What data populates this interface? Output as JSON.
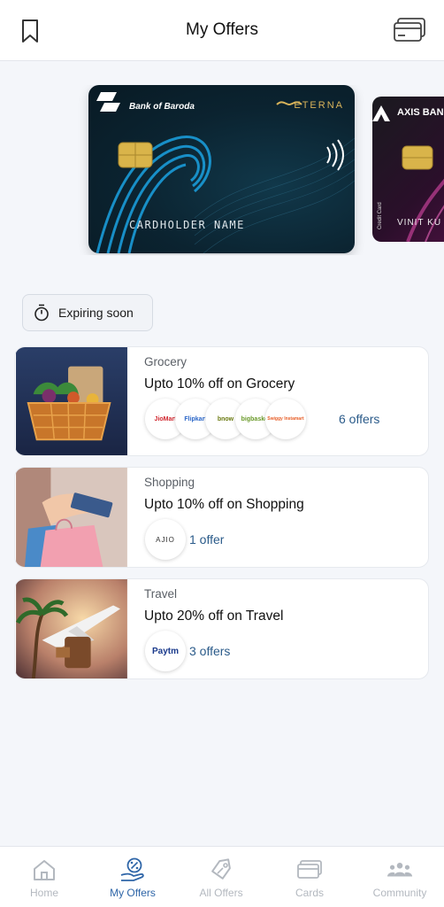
{
  "header": {
    "title": "My Offers",
    "left_icon": "bookmark-icon",
    "right_icon": "cards-stack-icon"
  },
  "cards": [
    {
      "bank": "Bank of Baroda",
      "variant": "ETERNA",
      "holder": "CARDHOLDER NAME"
    },
    {
      "bank": "AXIS BAN",
      "holder": "VINIT KU",
      "label": "Credit Card"
    }
  ],
  "filter": {
    "label": "Expiring soon",
    "icon": "stopwatch-icon"
  },
  "offers": [
    {
      "category": "Grocery",
      "headline": "Upto 10% off on Grocery",
      "merchants": [
        "JioMart",
        "Flipkart",
        "bnow",
        "bigbasket",
        "Swiggy Instamart"
      ],
      "count": "6 offers"
    },
    {
      "category": "Shopping",
      "headline": "Upto 10% off on Shopping",
      "merchants": [
        "AJIO"
      ],
      "count": "1 offer"
    },
    {
      "category": "Travel",
      "headline": "Upto 20% off on Travel",
      "merchants": [
        "Paytm"
      ],
      "count": "3 offers"
    }
  ],
  "nav": [
    {
      "label": "Home",
      "icon": "home-icon",
      "active": false
    },
    {
      "label": "My Offers",
      "icon": "offers-percent-icon",
      "active": true
    },
    {
      "label": "All Offers",
      "icon": "tag-icon",
      "active": false
    },
    {
      "label": "Cards",
      "icon": "cards-icon",
      "active": false
    },
    {
      "label": "Community",
      "icon": "community-icon",
      "active": false
    }
  ],
  "colors": {
    "accent": "#2f66a8",
    "link": "#2b5b8a",
    "inactive": "#b3b8bf"
  }
}
